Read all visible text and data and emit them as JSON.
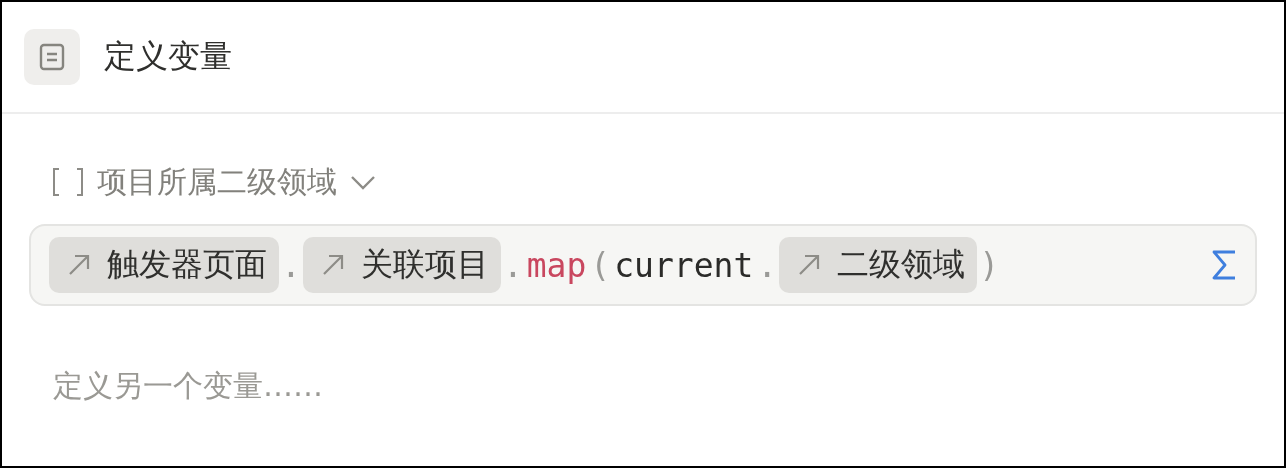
{
  "header": {
    "title": "定义变量"
  },
  "variable": {
    "name": "项目所属二级领域",
    "expanded": false
  },
  "formula": {
    "tokens": [
      {
        "kind": "property",
        "text": "触发器页面"
      },
      {
        "kind": "punct",
        "text": "."
      },
      {
        "kind": "property",
        "text": "关联项目"
      },
      {
        "kind": "punct",
        "text": "."
      },
      {
        "kind": "function",
        "text": "map"
      },
      {
        "kind": "punct",
        "text": "("
      },
      {
        "kind": "text",
        "text": "current"
      },
      {
        "kind": "punct",
        "text": "."
      },
      {
        "kind": "property",
        "text": "二级领域"
      },
      {
        "kind": "punct",
        "text": ")"
      }
    ]
  },
  "add_variable": {
    "placeholder": "定义另一个变量……"
  }
}
